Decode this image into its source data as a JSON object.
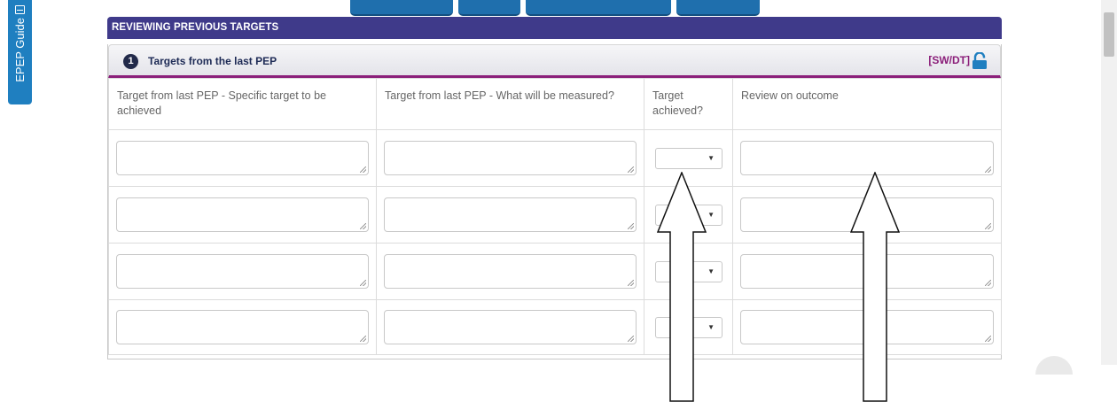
{
  "guide_tab": {
    "label": "EPEP Guide"
  },
  "section": {
    "title": "REVIEWING PREVIOUS TARGETS"
  },
  "panel": {
    "number": "1",
    "title": "Targets from the last PEP",
    "role_tag": "[SW/DT]",
    "lock_color": "#1f7fc0"
  },
  "table": {
    "headers": [
      "Target from last PEP - Specific target to be achieved",
      "Target from last PEP - What will be measured?",
      "Target achieved?",
      "Review on outcome"
    ],
    "rows": [
      {
        "target": "",
        "measured": "",
        "achieved": "",
        "review": ""
      },
      {
        "target": "",
        "measured": "",
        "achieved": "",
        "review": ""
      },
      {
        "target": "",
        "measured": "",
        "achieved": "",
        "review": ""
      },
      {
        "target": "",
        "measured": "",
        "achieved": "",
        "review": ""
      }
    ]
  },
  "colors": {
    "section_header": "#3f3a8a",
    "accent_border": "#8b1f7a",
    "guide_tab": "#1f7fc0"
  }
}
